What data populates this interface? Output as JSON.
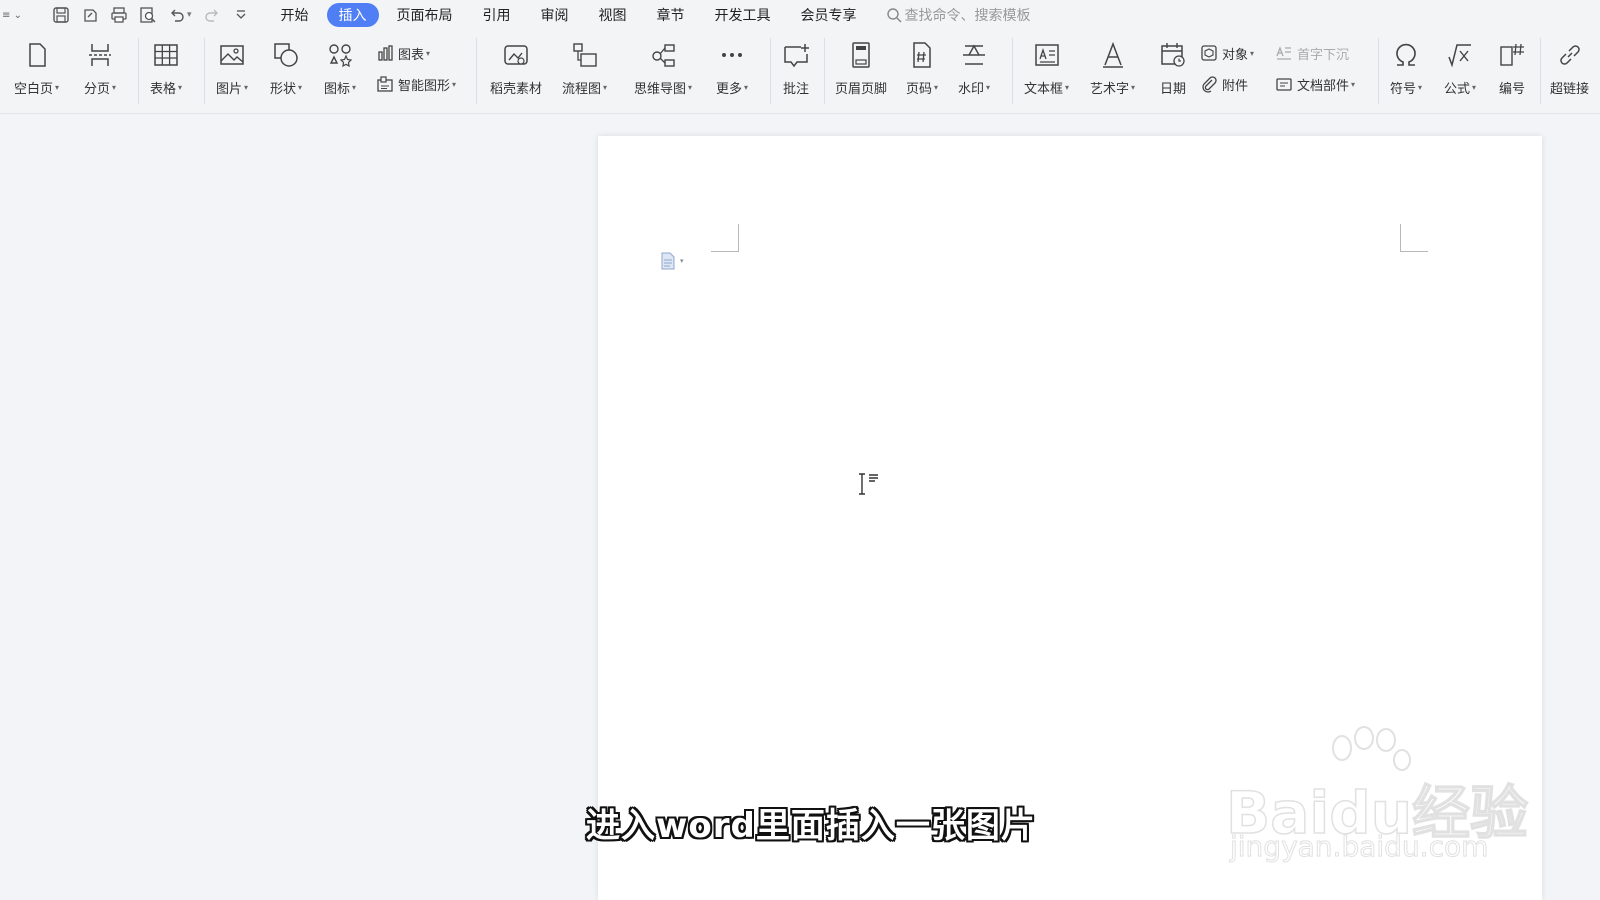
{
  "menubar": {
    "tabs": [
      "开始",
      "插入",
      "页面布局",
      "引用",
      "审阅",
      "视图",
      "章节",
      "开发工具",
      "会员专享"
    ],
    "active_tab": "插入",
    "search_placeholder": "查找命令、搜索模板"
  },
  "ribbon": {
    "blank_page": "空白页",
    "page_break": "分页",
    "table": "表格",
    "picture": "图片",
    "shape": "形状",
    "icon": "图标",
    "chart": "图表",
    "smart_art": "智能图形",
    "docer_material": "稻壳素材",
    "flowchart": "流程图",
    "mind_map": "思维导图",
    "more": "更多",
    "comment": "批注",
    "header_footer": "页眉页脚",
    "page_number": "页码",
    "watermark": "水印",
    "text_box": "文本框",
    "word_art": "艺术字",
    "date": "日期",
    "object": "对象",
    "drop_cap": "首字下沉",
    "attachment": "附件",
    "doc_parts": "文档部件",
    "symbol": "符号",
    "formula": "公式",
    "numbering": "编号",
    "hyperlink": "超链接"
  },
  "subtitle": "进入word里面插入一张图片",
  "watermark": {
    "main": "Baidu经验",
    "sub": "jingyan.baidu.com"
  },
  "colors": {
    "accent": "#4f7ef5",
    "toolbar_bg": "#f3f4f6",
    "workspace_bg": "#f2f4f7"
  }
}
